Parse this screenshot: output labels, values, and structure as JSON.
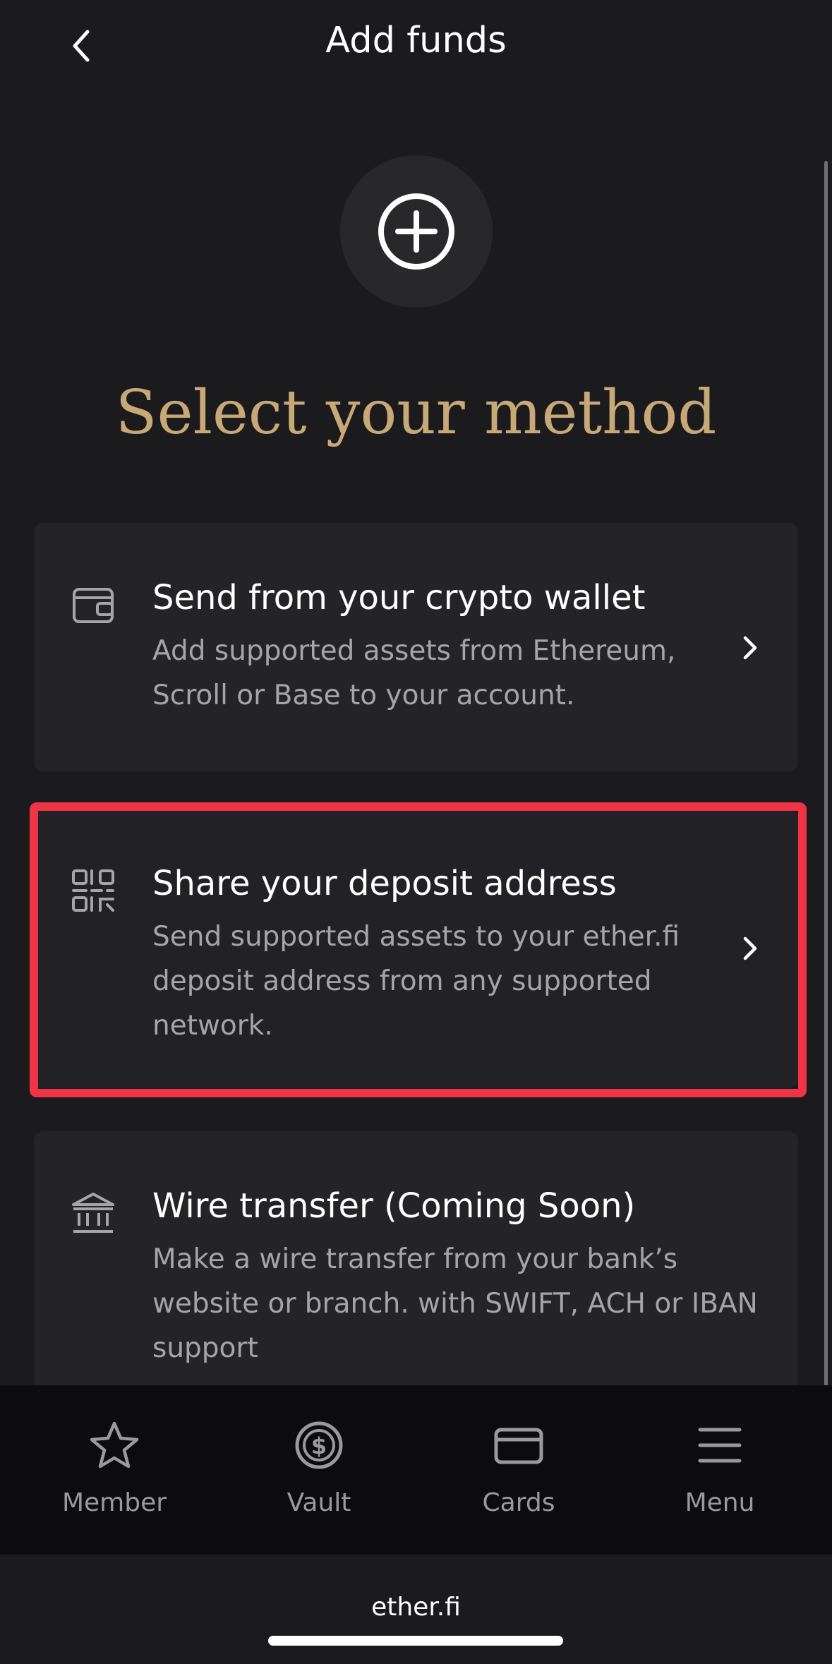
{
  "header": {
    "title": "Add funds"
  },
  "main": {
    "title": "Select your method"
  },
  "methods": [
    {
      "title": "Send from your crypto wallet",
      "description": "Add supported assets from Ethereum, Scroll or Base to your account.",
      "icon": "wallet-icon"
    },
    {
      "title": "Share your deposit address",
      "description": "Send supported assets to your ether.fi deposit address from any supported network.",
      "icon": "qr-code-icon",
      "highlighted": true
    },
    {
      "title": "Wire transfer (Coming Soon)",
      "description": "Make a wire transfer from your bank’s website or branch. with SWIFT, ACH or IBAN support",
      "icon": "bank-icon"
    }
  ],
  "tabs": [
    {
      "label": "Member",
      "icon": "star-icon"
    },
    {
      "label": "Vault",
      "icon": "dollar-circle-icon"
    },
    {
      "label": "Cards",
      "icon": "card-icon"
    },
    {
      "label": "Menu",
      "icon": "menu-icon"
    }
  ],
  "browser": {
    "url": "ether.fi"
  },
  "colors": {
    "accent": "#c7a877",
    "background": "#1b1b1e",
    "highlight": "#ef3445"
  }
}
